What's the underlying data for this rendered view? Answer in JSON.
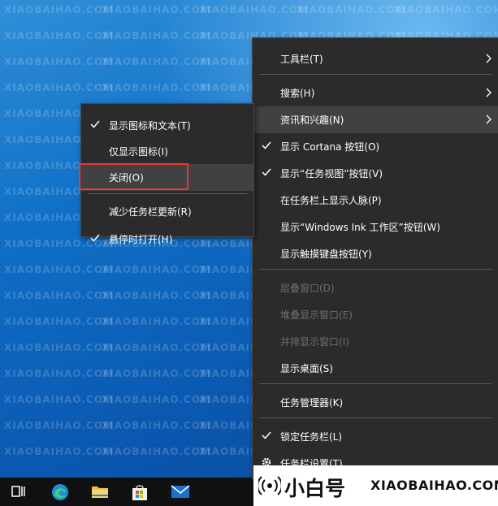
{
  "taskbar": {
    "icons": [
      "task-view-icon",
      "edge-icon",
      "file-explorer-icon",
      "store-icon",
      "mail-icon"
    ]
  },
  "main_menu": {
    "items": [
      {
        "label": "工具栏(T)",
        "submenu": true
      },
      {
        "label": "搜索(H)",
        "submenu": true
      },
      {
        "label": "资讯和兴趣(N)",
        "submenu": true,
        "highlighted": true
      },
      {
        "label": "显示 Cortana 按钮(O)",
        "checked": true
      },
      {
        "label": "显示“任务视图”按钮(V)",
        "checked": true
      },
      {
        "label": "在任务栏上显示人脉(P)"
      },
      {
        "label": "显示“Windows Ink 工作区”按钮(W)"
      },
      {
        "label": "显示触摸键盘按钮(Y)"
      },
      {
        "label": "层叠窗口(D)",
        "disabled": true
      },
      {
        "label": "堆叠显示窗口(E)",
        "disabled": true
      },
      {
        "label": "并排显示窗口(I)",
        "disabled": true
      },
      {
        "label": "显示桌面(S)"
      },
      {
        "label": "任务管理器(K)"
      },
      {
        "label": "锁定任务栏(L)",
        "checked": true
      },
      {
        "label": "任务栏设置(T)",
        "icon": "gear-icon"
      }
    ]
  },
  "sub_menu": {
    "items": [
      {
        "label": "显示图标和文本(T)",
        "checked": true
      },
      {
        "label": "仅显示图标(I)"
      },
      {
        "label": "关闭(O)",
        "highlighted": true,
        "annotated": true
      },
      {
        "label": "减少任务栏更新(R)"
      },
      {
        "label": "悬停时打开(H)",
        "checked": true
      }
    ]
  },
  "watermark": {
    "text": "XIAOBAIHAO.COM",
    "cn": "小白号",
    "en": "XIAOBAIHAO.COM",
    "icon": "signal-wave-icon"
  },
  "colors": {
    "menu_bg": "#2b2b2b",
    "menu_highlight": "#414141",
    "disabled_text": "#6f6f6f",
    "annotation_red": "#e23a3a",
    "taskbar_bg": "#101010"
  }
}
